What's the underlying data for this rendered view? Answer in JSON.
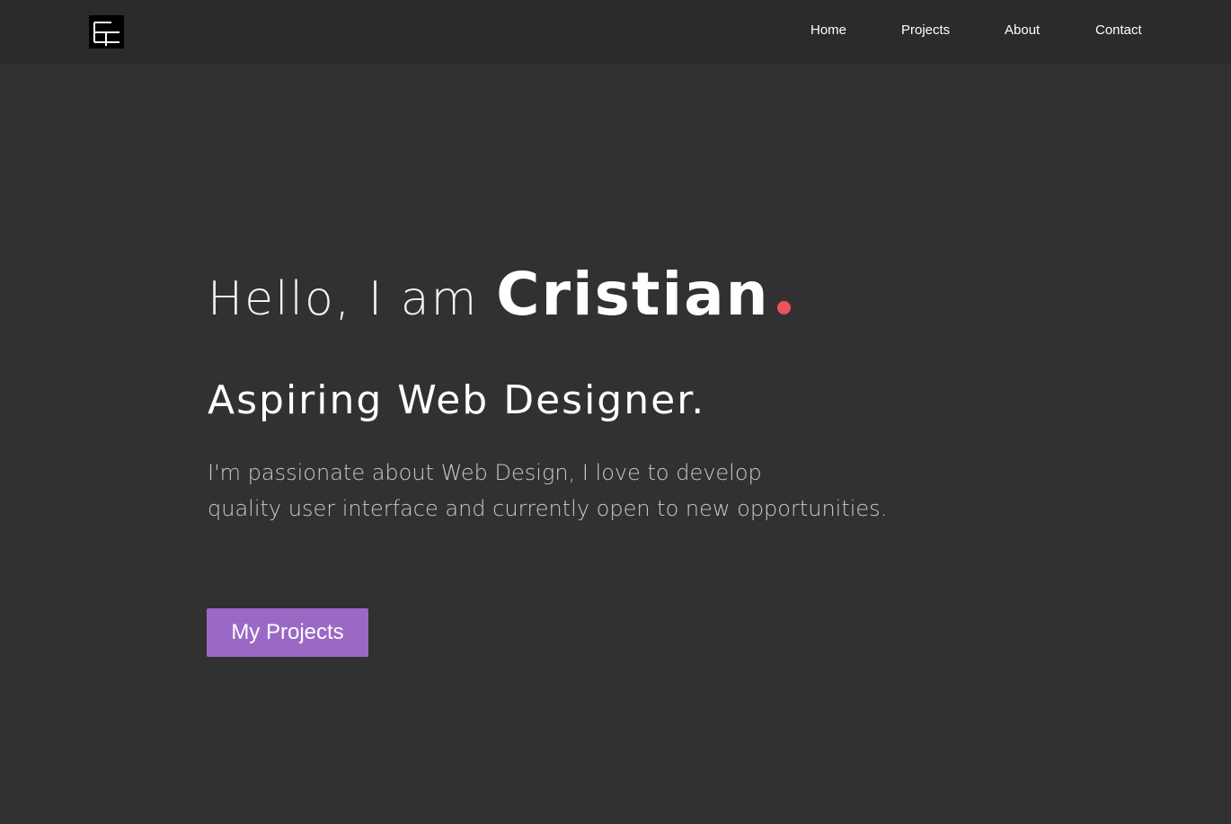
{
  "navbar": {
    "logo_icon": "monogram-logo-icon",
    "links": [
      {
        "label": "Home"
      },
      {
        "label": "Projects"
      },
      {
        "label": "About"
      },
      {
        "label": "Contact"
      }
    ]
  },
  "hero": {
    "greeting": "Hello, I am",
    "name": "Cristian",
    "subtitle": "Aspiring Web Designer.",
    "description_line1": "I'm passionate about Web Design, I love to develop",
    "description_line2": "quality user interface and currently open to new opportunities.",
    "button_label": "My Projects"
  },
  "colors": {
    "background": "#313131",
    "navbar": "#2b2b2b",
    "accent_dot": "#f0525a",
    "button": "#9b69c5"
  }
}
